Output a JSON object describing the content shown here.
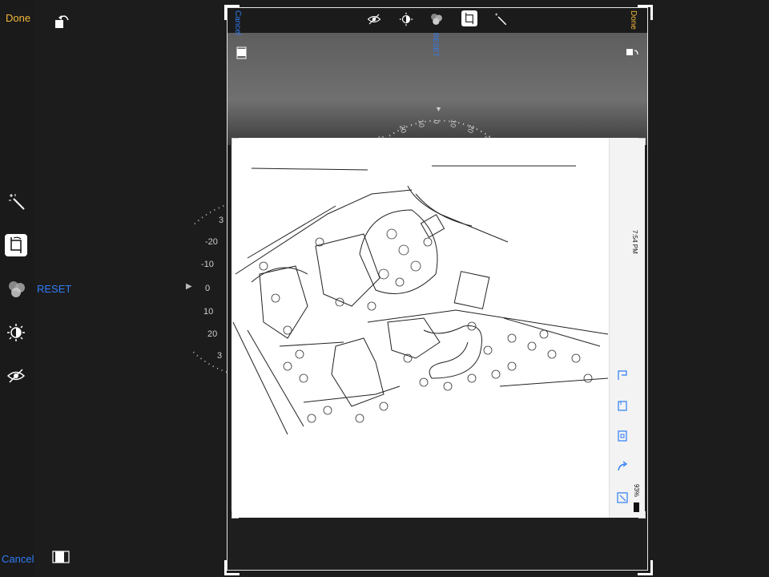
{
  "header": {
    "done_label": "Done"
  },
  "adjust": {
    "reset_label": "RESET"
  },
  "footer": {
    "cancel_label": "Cancel"
  },
  "dial": {
    "labels": [
      "3",
      "-20",
      "-10",
      "0",
      "10",
      "20",
      "3"
    ]
  },
  "inner": {
    "cancel_label": "Cancel",
    "done_label": "Done",
    "reset_label": "RESET",
    "dial_labels": [
      "3",
      "20",
      "10",
      "0",
      "10",
      "20",
      "3"
    ],
    "status_time": "7:54 PM",
    "battery_percent": "93%"
  },
  "colors": {
    "accent_yellow": "#f0b83a",
    "accent_blue": "#2f7cf6",
    "background": "#1c1c1c"
  },
  "icons": [
    "rotate-icon",
    "magic-wand-icon",
    "crop-icon",
    "color-filters-icon",
    "light-adjust-icon",
    "hide-eye-icon",
    "aspect-ratio-icon"
  ]
}
